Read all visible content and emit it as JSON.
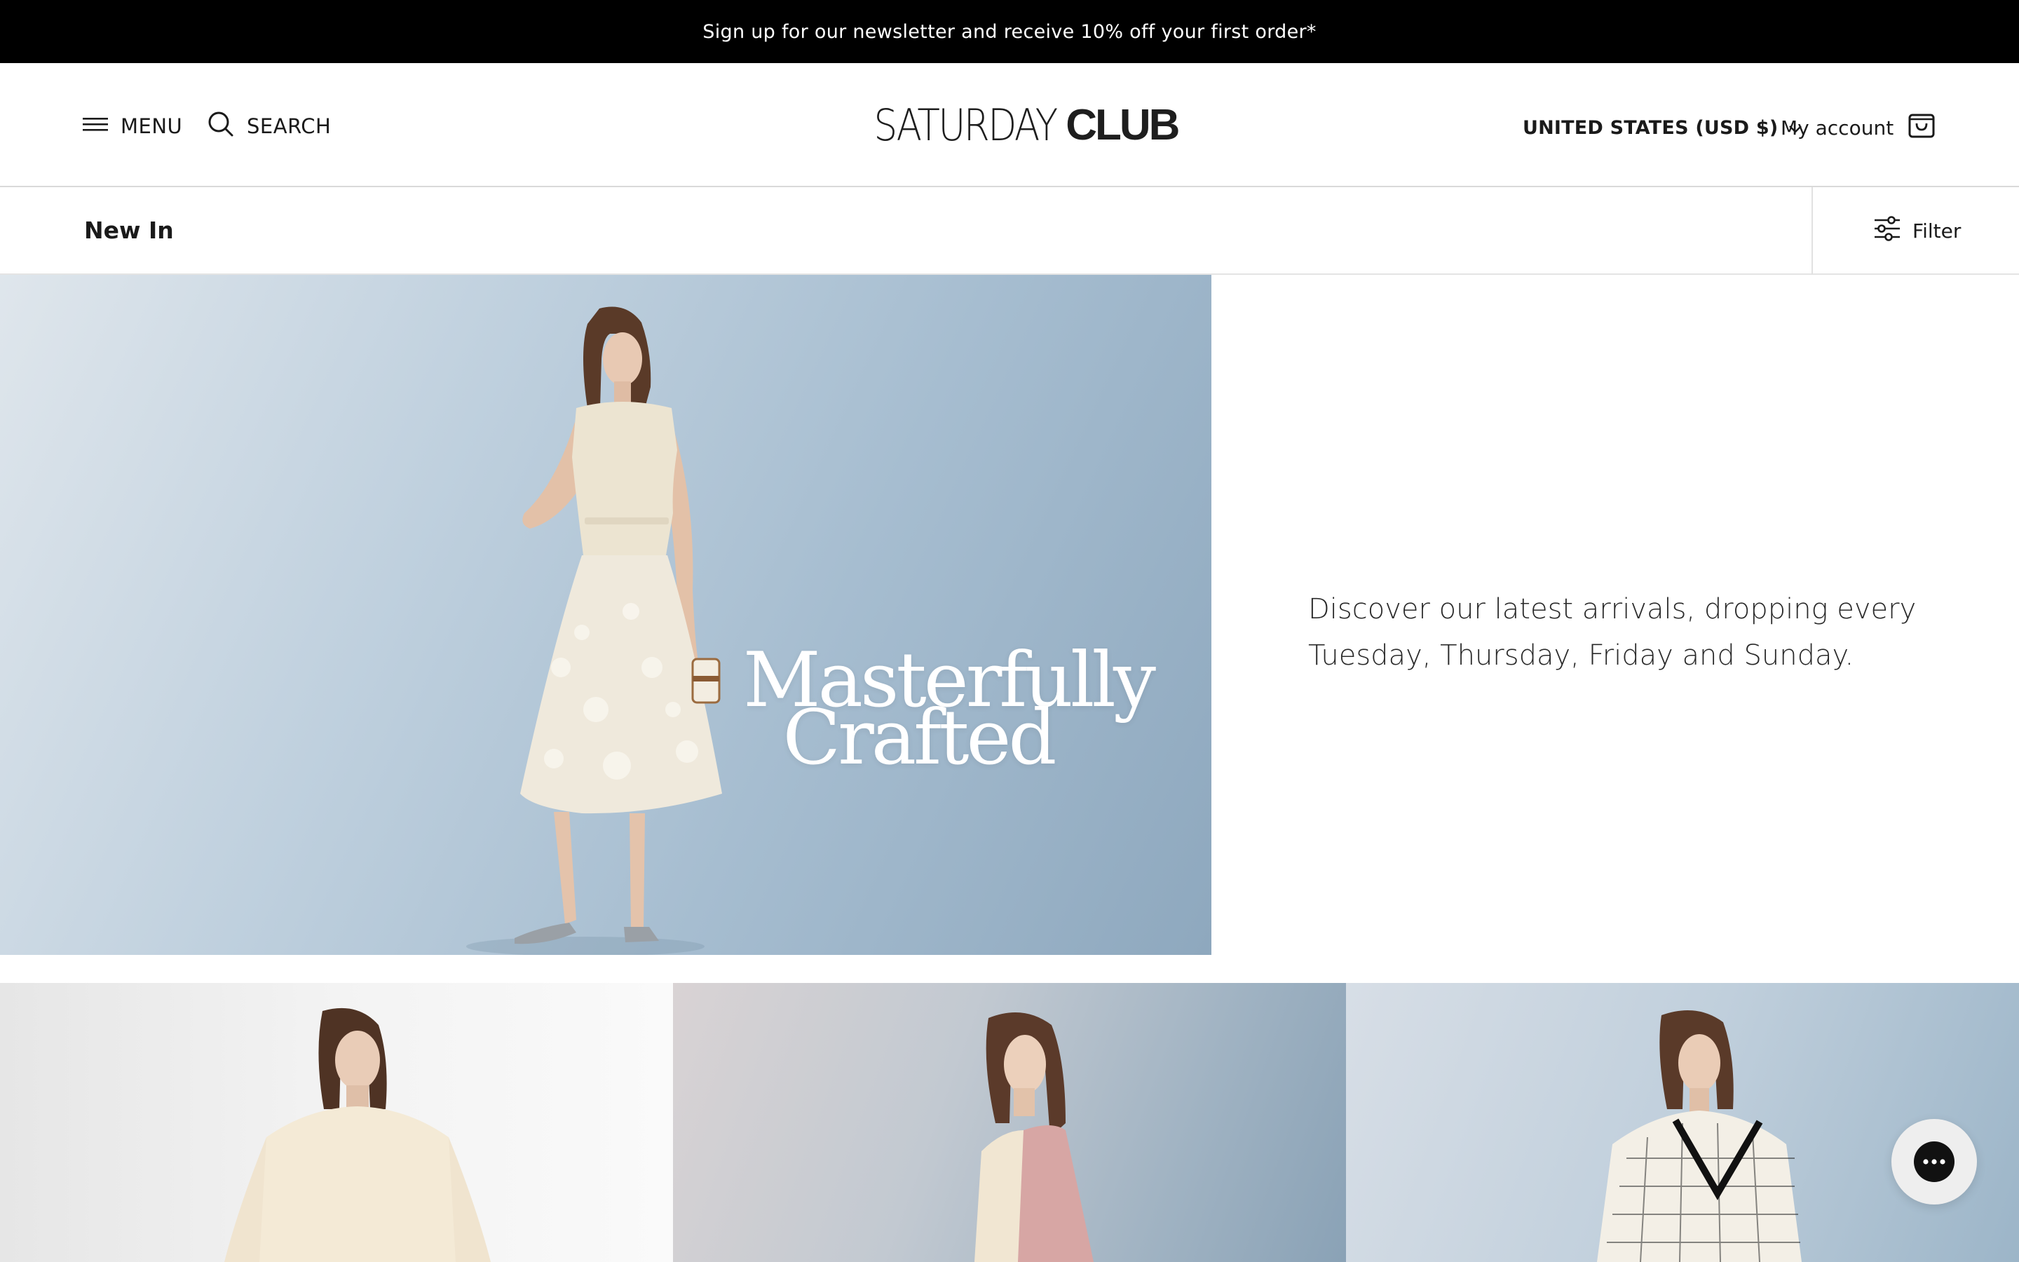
{
  "announcement": {
    "text": "Sign up for our newsletter and receive 10% off your first order*"
  },
  "header": {
    "menu_label": "MENU",
    "search_label": "SEARCH",
    "logo_light": "SATURDAY",
    "logo_bold": "CLUB",
    "country_label": "UNITED STATES (USD $)",
    "account_label": "My account"
  },
  "subbar": {
    "title": "New In",
    "filter_label": "Filter"
  },
  "hero": {
    "overlay_line1": "Masterfully",
    "overlay_line2": "Crafted",
    "description": "Discover our latest arrivals, dropping every Tuesday, Thursday, Friday and Sunday."
  },
  "icons": {
    "menu": "hamburger-icon",
    "search": "search-icon",
    "country": "chevron-down-icon",
    "cart": "shopping-bag-icon",
    "filter": "sliders-icon",
    "chat": "chat-bubble-icon"
  }
}
